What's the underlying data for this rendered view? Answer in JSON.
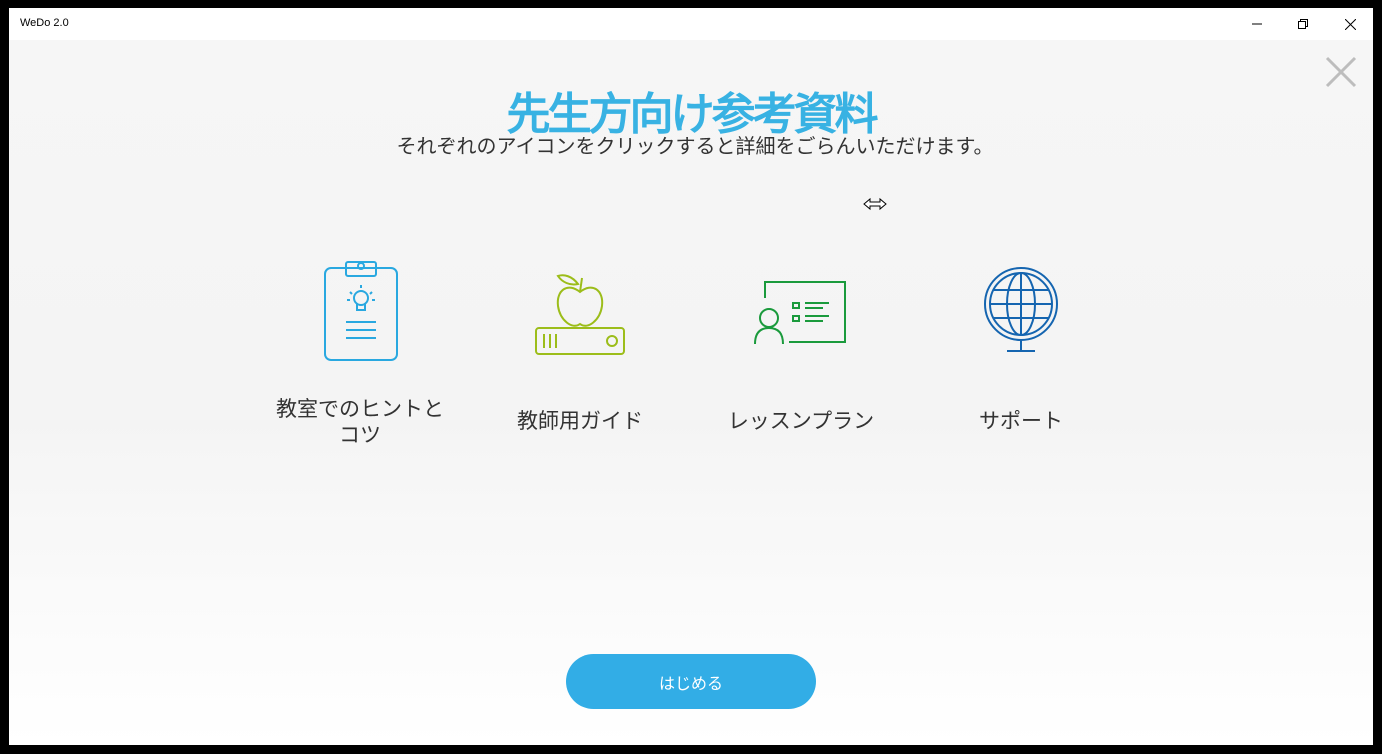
{
  "window": {
    "title": "WeDo 2.0"
  },
  "page": {
    "heading": "先生方向け参考資料",
    "subheading": "それぞれのアイコンをクリックすると詳細をごらんいただけます。"
  },
  "cards": [
    {
      "label": "教室でのヒントとコツ",
      "icon": "clipboard-lightbulb-icon",
      "color": "#29a8e0"
    },
    {
      "label": "教師用ガイド",
      "icon": "apple-book-icon",
      "color": "#9cbd1a"
    },
    {
      "label": "レッスンプラン",
      "icon": "presentation-board-icon",
      "color": "#1a9a3c"
    },
    {
      "label": "サポート",
      "icon": "globe-icon",
      "color": "#1565b0"
    }
  ],
  "start_button": {
    "label": "はじめる"
  },
  "colors": {
    "accent": "#32ade6",
    "heading": "#38b2e3"
  }
}
